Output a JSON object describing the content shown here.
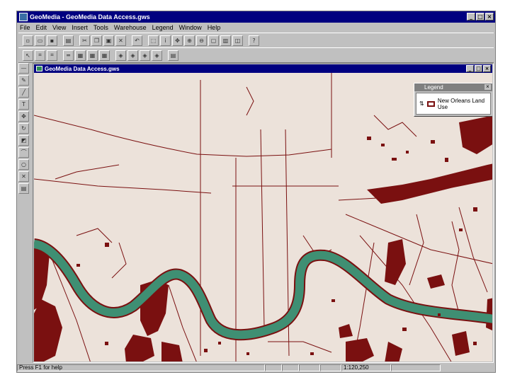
{
  "app": {
    "title": "GeoMedia - GeoMedia Data Access.gws",
    "menu": [
      "File",
      "Edit",
      "View",
      "Insert",
      "Tools",
      "Warehouse",
      "Legend",
      "Window",
      "Help"
    ]
  },
  "map_window": {
    "title": "GeoMedia Data Access.gws"
  },
  "legend": {
    "title": "Legend",
    "item_label": "New Orleans Land Use"
  },
  "status": {
    "help_text": "Press F1 for help",
    "scale": "1:120,250"
  },
  "colors": {
    "map_background": "#ece2da",
    "land_parcel": "#7a1010",
    "river": "#3f8f73"
  },
  "icons": {
    "toolbar_row1": [
      "new-icon",
      "open-icon",
      "save-icon",
      "print-icon",
      "cut-icon",
      "copy-icon",
      "paste-icon",
      "delete-icon",
      "undo-icon",
      "select-icon",
      "info-icon",
      "pan-icon",
      "zoom-in-icon",
      "zoom-out-icon",
      "fit-icon",
      "refresh-icon",
      "properties-icon",
      "help-icon"
    ],
    "toolbar_row2": [
      "pointer-icon",
      "select-tool-icon",
      "select-set-icon",
      "line-icon",
      "area-icon",
      "point-icon",
      "text-icon",
      "layer-icon",
      "query-icon",
      "analysis-icon",
      "output-icon",
      "edit-icon"
    ]
  }
}
